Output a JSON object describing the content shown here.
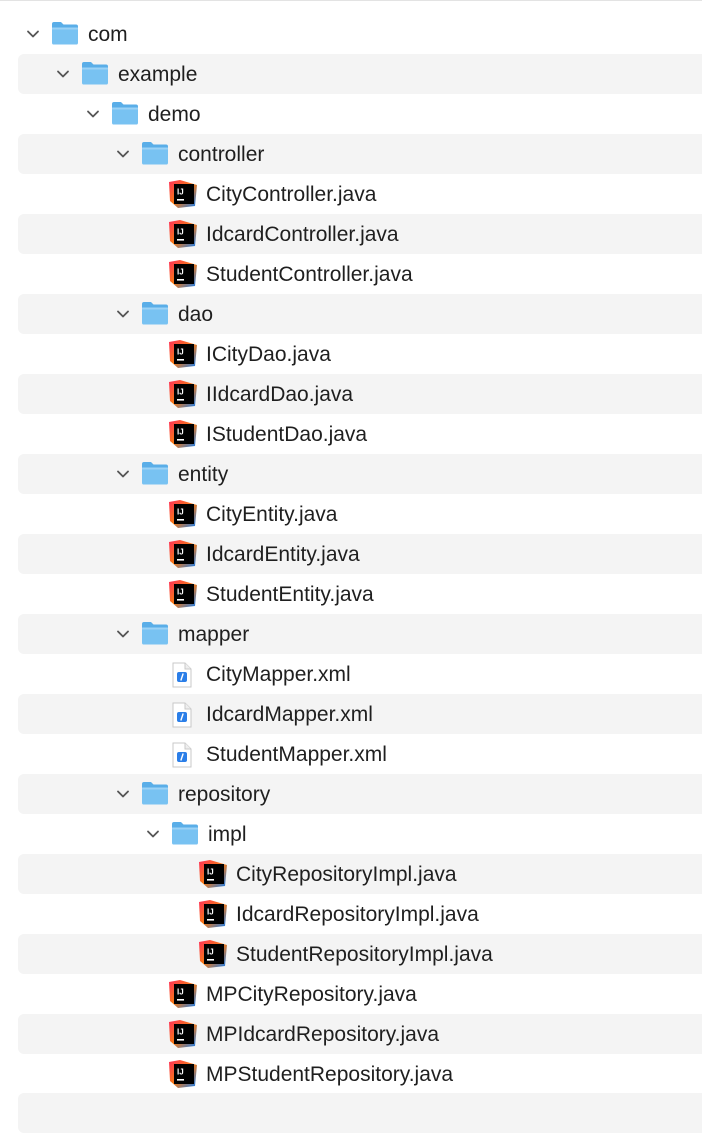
{
  "tree": {
    "items": [
      {
        "label": "com",
        "type": "folder",
        "depth": 0,
        "expanded": true
      },
      {
        "label": "example",
        "type": "folder",
        "depth": 1,
        "expanded": true
      },
      {
        "label": "demo",
        "type": "folder",
        "depth": 2,
        "expanded": true
      },
      {
        "label": "controller",
        "type": "folder",
        "depth": 3,
        "expanded": true
      },
      {
        "label": "CityController.java",
        "type": "java",
        "depth": 4
      },
      {
        "label": "IdcardController.java",
        "type": "java",
        "depth": 4
      },
      {
        "label": "StudentController.java",
        "type": "java",
        "depth": 4
      },
      {
        "label": "dao",
        "type": "folder",
        "depth": 3,
        "expanded": true
      },
      {
        "label": "ICityDao.java",
        "type": "java",
        "depth": 4
      },
      {
        "label": "IIdcardDao.java",
        "type": "java",
        "depth": 4
      },
      {
        "label": "IStudentDao.java",
        "type": "java",
        "depth": 4
      },
      {
        "label": "entity",
        "type": "folder",
        "depth": 3,
        "expanded": true
      },
      {
        "label": "CityEntity.java",
        "type": "java",
        "depth": 4
      },
      {
        "label": "IdcardEntity.java",
        "type": "java",
        "depth": 4
      },
      {
        "label": "StudentEntity.java",
        "type": "java",
        "depth": 4
      },
      {
        "label": "mapper",
        "type": "folder",
        "depth": 3,
        "expanded": true
      },
      {
        "label": "CityMapper.xml",
        "type": "xml",
        "depth": 4
      },
      {
        "label": "IdcardMapper.xml",
        "type": "xml",
        "depth": 4
      },
      {
        "label": "StudentMapper.xml",
        "type": "xml",
        "depth": 4
      },
      {
        "label": "repository",
        "type": "folder",
        "depth": 3,
        "expanded": true
      },
      {
        "label": "impl",
        "type": "folder",
        "depth": 4,
        "expanded": true
      },
      {
        "label": "CityRepositoryImpl.java",
        "type": "java",
        "depth": 5
      },
      {
        "label": "IdcardRepositoryImpl.java",
        "type": "java",
        "depth": 5
      },
      {
        "label": "StudentRepositoryImpl.java",
        "type": "java",
        "depth": 5
      },
      {
        "label": "MPCityRepository.java",
        "type": "java",
        "depth": 4
      },
      {
        "label": "MPIdcardRepository.java",
        "type": "java",
        "depth": 4
      },
      {
        "label": "MPStudentRepository.java",
        "type": "java",
        "depth": 4
      }
    ]
  },
  "icons": {
    "folder": "folder-icon",
    "java": "intellij-java-file-icon",
    "xml": "xml-file-icon",
    "chevron": "chevron-down-icon"
  },
  "colors": {
    "stripe": "#f4f4f4",
    "folder_front": "#78c2f2",
    "folder_back": "#5aaee8",
    "text": "#1f1f1f"
  }
}
